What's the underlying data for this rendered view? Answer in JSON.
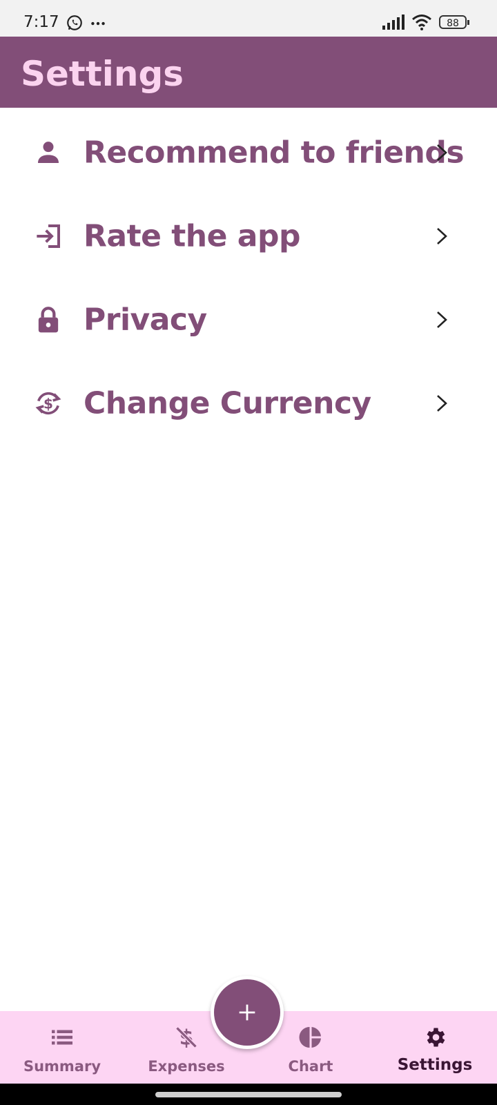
{
  "status_bar": {
    "time": "7:17",
    "battery": "88",
    "icons": [
      "whatsapp-icon",
      "more-dots-icon",
      "signal-icon",
      "wifi-icon",
      "battery-icon"
    ]
  },
  "app_bar": {
    "title": "Settings"
  },
  "menu": {
    "items": [
      {
        "label": "Recommend to friends",
        "icon": "person-icon"
      },
      {
        "label": "Rate the app",
        "icon": "login-arrow-icon"
      },
      {
        "label": "Privacy",
        "icon": "lock-icon"
      },
      {
        "label": "Change Currency",
        "icon": "currency-exchange-icon"
      }
    ]
  },
  "fab": {
    "icon": "plus-icon"
  },
  "bottom_nav": {
    "items": [
      {
        "label": "Summary",
        "icon": "list-icon",
        "active": false
      },
      {
        "label": "Expenses",
        "icon": "no-money-icon",
        "active": false
      },
      {
        "label": "Chart",
        "icon": "pie-chart-icon",
        "active": false
      },
      {
        "label": "Settings",
        "icon": "gear-icon",
        "active": true
      }
    ]
  },
  "colors": {
    "primary": "#824e78",
    "title_text": "#fbd3ef",
    "nav_background": "#fdd5f3",
    "nav_inactive": "#8a5a80",
    "nav_active": "#3a1534"
  }
}
